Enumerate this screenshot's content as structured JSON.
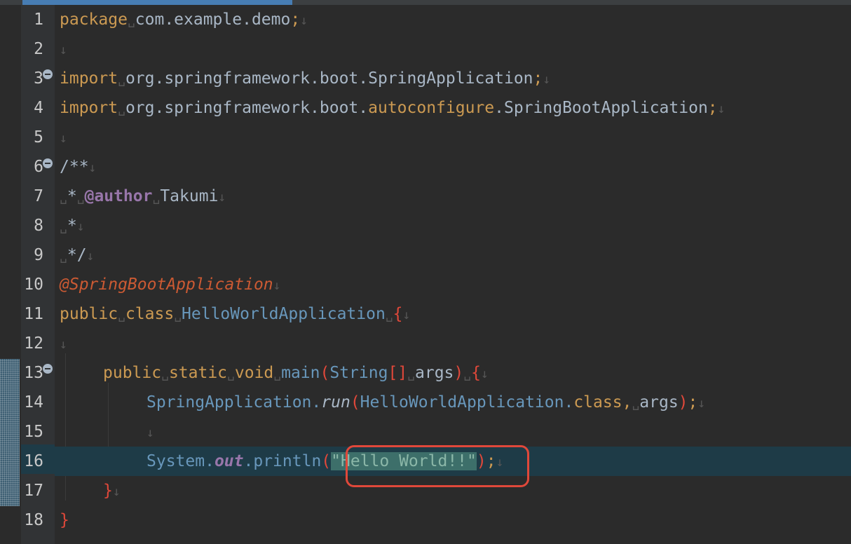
{
  "editor": {
    "colors": {
      "background": "#2b2b2b",
      "gutter": "#313335",
      "current_line": "#1e3b47",
      "keyword": "#cc7832",
      "string": "#6a8759",
      "annotation_highlight": "#e0483a"
    },
    "lines": [
      {
        "num": "1",
        "text": "package com.example.demo;"
      },
      {
        "num": "2",
        "text": ""
      },
      {
        "num": "3",
        "text": "import org.springframework.boot.SpringApplication;"
      },
      {
        "num": "4",
        "text": "import org.springframework.boot.autoconfigure.SpringBootApplication;"
      },
      {
        "num": "5",
        "text": ""
      },
      {
        "num": "6",
        "text": "/**"
      },
      {
        "num": "7",
        "text": " * @author Takumi"
      },
      {
        "num": "8",
        "text": " *"
      },
      {
        "num": "9",
        "text": " */"
      },
      {
        "num": "10",
        "text": "@SpringBootApplication"
      },
      {
        "num": "11",
        "text": "public class HelloWorldApplication {"
      },
      {
        "num": "12",
        "text": ""
      },
      {
        "num": "13",
        "text": "    public static void main(String[] args) {"
      },
      {
        "num": "14",
        "text": "        SpringApplication.run(HelloWorldApplication.class, args);"
      },
      {
        "num": "15",
        "text": ""
      },
      {
        "num": "16",
        "text": "        System.out.println(\"Hello World!!\");"
      },
      {
        "num": "17",
        "text": "    }"
      },
      {
        "num": "18",
        "text": "}"
      }
    ],
    "tokens": {
      "l1": {
        "kw": "package",
        "rest": "com.example.demo",
        "semi": ";"
      },
      "l3": {
        "kw": "import",
        "pkg": "org.springframework.boot.",
        "cls": "SpringApplication",
        "semi": ";"
      },
      "l4": {
        "kw": "import",
        "pkg": "org.springframework.boot.",
        "sub": "autoconfigure",
        "dot": ".",
        "cls": "SpringBootApplication",
        "semi": ";"
      },
      "l6": {
        "doc": "/**"
      },
      "l7": {
        "star": "*",
        "tag": "@author",
        "name": "Takumi"
      },
      "l8": {
        "star": "*"
      },
      "l9": {
        "end": "*/"
      },
      "l10": {
        "ann": "@SpringBootApplication"
      },
      "l11": {
        "kw1": "public",
        "kw2": "class",
        "cls": "HelloWorldApplication",
        "brace": "{"
      },
      "l13": {
        "kw1": "public",
        "kw2": "static",
        "kw3": "void",
        "meth": "main",
        "open": "(",
        "type": "String",
        "arr": "[]",
        "arg": "args",
        "close": ")",
        "brace": "{"
      },
      "l14": {
        "cls": "SpringApplication",
        "dot": ".",
        "meth": "run",
        "open": "(",
        "cls2": "HelloWorldApplication",
        "dot2": ".",
        "kw": "class",
        "comma": ",",
        "arg": "args",
        "close": ")",
        "semi": ";"
      },
      "l16": {
        "cls": "System",
        "dot": ".",
        "field": "out",
        "dot2": ".",
        "meth": "println",
        "open": "(",
        "str": "\"Hello World!!\"",
        "close": ")",
        "semi": ";"
      },
      "l17": {
        "brace": "}"
      },
      "l18": {
        "brace": "}"
      }
    },
    "ws_mark": "↓",
    "space_mark": "␣"
  }
}
